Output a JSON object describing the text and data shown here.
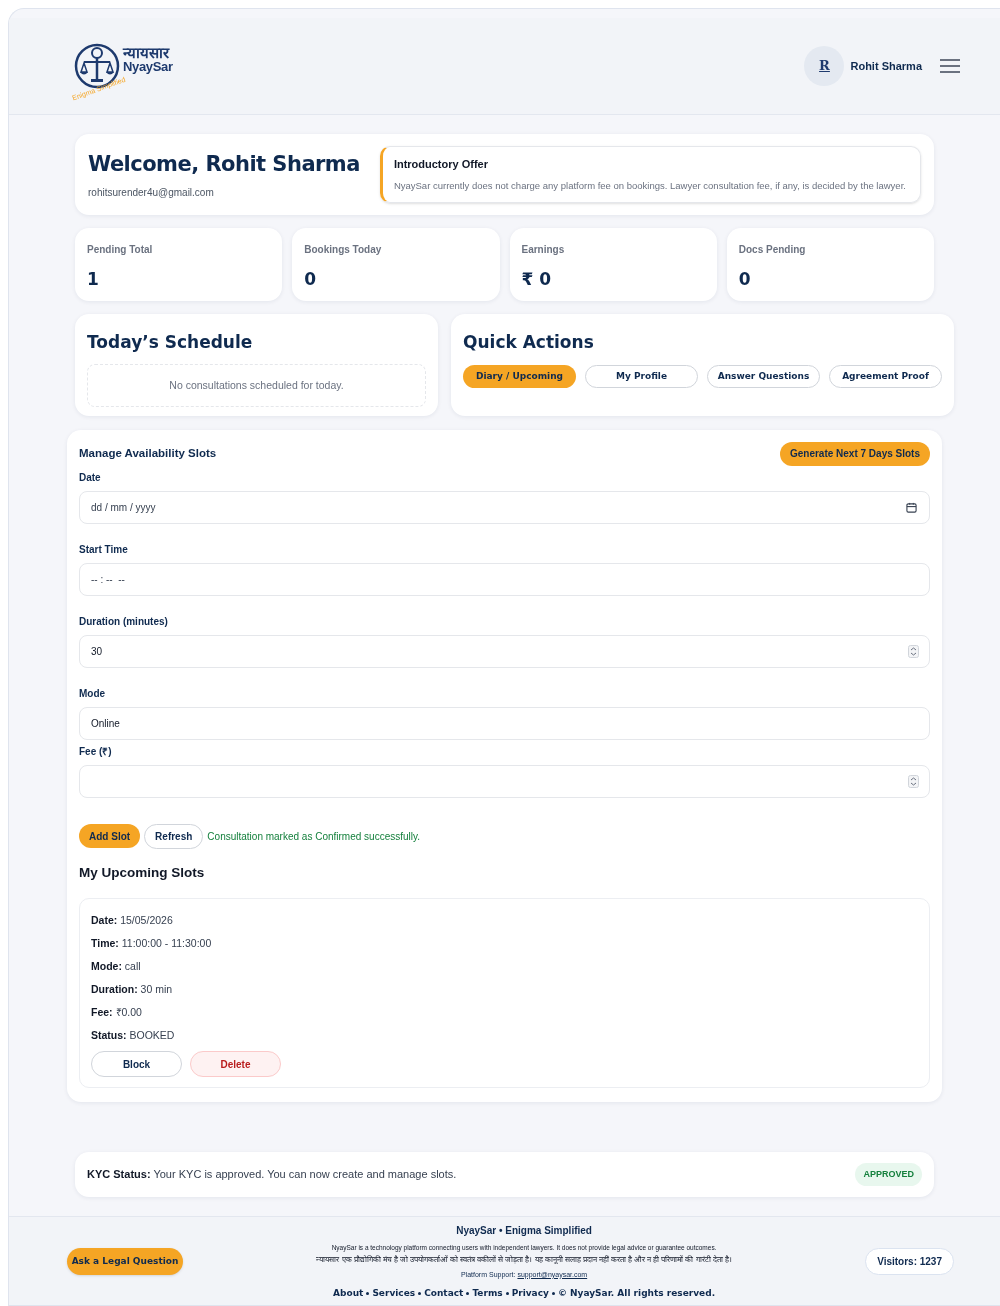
{
  "header": {
    "logo": {
      "hindi": "न्यायसार",
      "name": "NyaySar",
      "tagline": "Enigma Simplified"
    },
    "user": {
      "initial": "R",
      "name": "Rohit Sharma"
    }
  },
  "welcome": {
    "title": "Welcome, Rohit Sharma",
    "email": "rohitsurender4u@gmail.com",
    "offer": {
      "title": "Introductory Offer",
      "text": "NyaySar currently does not charge any platform fee on bookings. Lawyer consultation fee, if any, is decided by the lawyer."
    }
  },
  "stats": [
    {
      "label": "Pending Total",
      "value": "1"
    },
    {
      "label": "Bookings Today",
      "value": "0"
    },
    {
      "label": "Earnings",
      "value": "₹ 0"
    },
    {
      "label": "Docs Pending",
      "value": "0"
    }
  ],
  "schedule": {
    "title": "Today’s Schedule",
    "empty": "No consultations scheduled for today."
  },
  "quick_actions": {
    "title": "Quick Actions",
    "buttons": [
      {
        "label": "Diary / Upcoming",
        "selected": true
      },
      {
        "label": "My Profile",
        "selected": false
      },
      {
        "label": "Answer Questions",
        "selected": false
      },
      {
        "label": "Agreement Proof",
        "selected": false
      }
    ]
  },
  "availability": {
    "title": "Manage Availability Slots",
    "generate_button": "Generate Next 7 Days Slots",
    "fields": [
      {
        "kind": "date",
        "label": "Date",
        "placeholder": "dd / mm / yyyy"
      },
      {
        "kind": "time",
        "label": "Start Time",
        "placeholder": "-- : --  --"
      },
      {
        "kind": "number",
        "label": "Duration (minutes)",
        "value": "30"
      },
      {
        "kind": "text",
        "label": "Mode",
        "value": "Online"
      },
      {
        "kind": "number",
        "label": "Fee (₹)"
      }
    ],
    "add_button": "Add Slot",
    "refresh_button": "Refresh",
    "message": "Consultation marked as Confirmed successfully."
  },
  "upcoming": {
    "title": "My Upcoming Slots",
    "slots": [
      {
        "details": [
          "**Date:** 15/05/2026",
          "**Time:** 11:00:00 - 11:30:00",
          "**Mode:** call",
          "**Duration:** 30 min",
          "**Fee:** ₹0.00",
          "**Status:** BOOKED"
        ],
        "block_button": "Block",
        "delete_button": "Delete"
      }
    ]
  },
  "kyc": {
    "text": "**KYC Status:** Your KYC is approved. You can now create and manage slots.",
    "badge": "APPROVED"
  },
  "footer": {
    "ask_button": "Ask a Legal Question",
    "title": "NyaySar • Enigma Simplified",
    "disclaimer_en": "NyaySar is a technology platform connecting users with independent lawyers. It does not provide legal advice or guarantee outcomes.",
    "disclaimer_hi": "न्यायसार एक प्रौद्योगिकी मंच है जो उपयोगकर्ताओं को स्वतंत्र वकीलों से जोड़ता है। यह कानूनी सलाह प्रदान नहीं करता है और न ही परिणामों की गारंटी देता है।",
    "support_label": "Platform Support:",
    "support_email": "support@nyaysar.com",
    "links": [
      "About",
      "Services",
      "Contact",
      "Terms",
      "Privacy"
    ],
    "copyright": "© NyaySar. All rights reserved.",
    "visitors": "Visitors: 1237"
  }
}
